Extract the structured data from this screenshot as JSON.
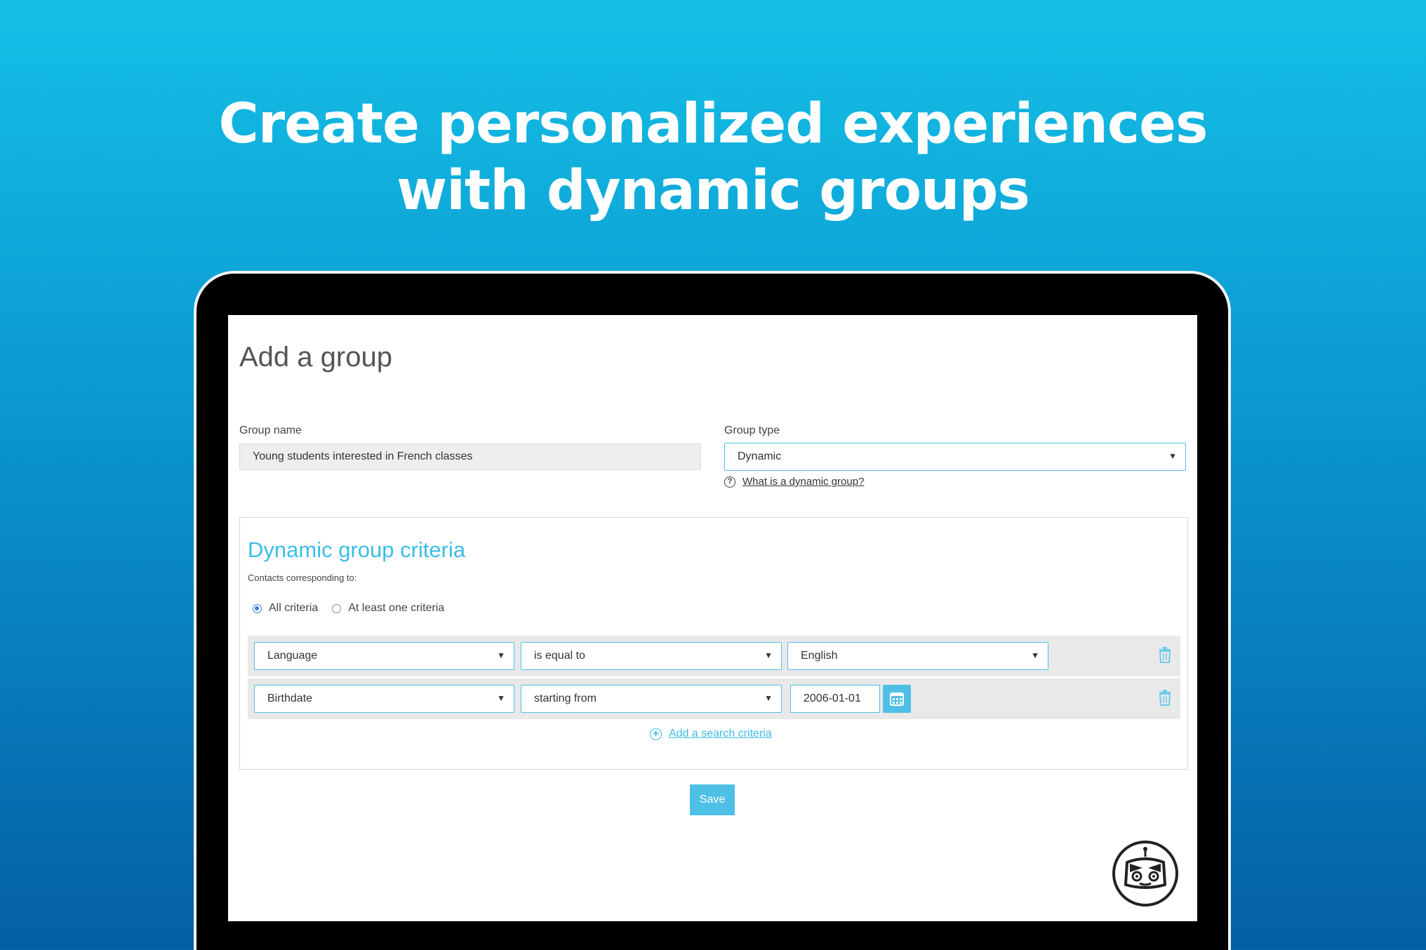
{
  "headline": {
    "line1": "Create personalized experiences",
    "line2": "with dynamic groups"
  },
  "page": {
    "title": "Add a group"
  },
  "group_name": {
    "label": "Group name",
    "value": "Young students interested in French classes"
  },
  "group_type": {
    "label": "Group type",
    "selected": "Dynamic",
    "help_link": "What is a dynamic group?"
  },
  "criteria": {
    "title": "Dynamic group criteria",
    "contacts_label": "Contacts corresponding to:",
    "match_options": [
      {
        "label": "All criteria",
        "checked": true
      },
      {
        "label": "At least one criteria",
        "checked": false
      }
    ],
    "rows": [
      {
        "field": "Language",
        "operator": "is equal to",
        "value": "English"
      },
      {
        "field": "Birthdate",
        "operator": "starting from",
        "value": "2006-01-01"
      }
    ],
    "add_label": "Add a search criteria"
  },
  "actions": {
    "save_label": "Save"
  },
  "colors": {
    "accent": "#4ec0e6",
    "title_accent": "#3bbde6",
    "background_top": "#14c0e6",
    "background_bottom": "#045fa3"
  }
}
